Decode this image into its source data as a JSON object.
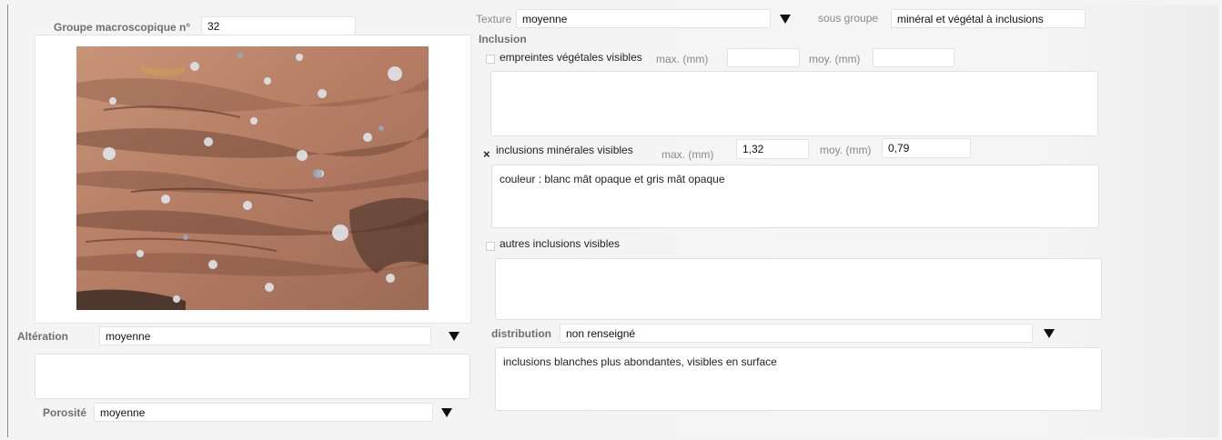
{
  "left": {
    "group_label": "Groupe macroscopique n°",
    "group_value": "32",
    "photo_alt": "Photo de l'échantillon",
    "alteration_label": "Altération",
    "alteration_value": "moyenne",
    "alteration_notes": "",
    "porosity_label": "Porosité",
    "porosity_value": "moyenne"
  },
  "texture": {
    "label": "Texture",
    "value": "moyenne",
    "subgroup_label": "sous groupe",
    "subgroup_value": "minéral et végétal à inclusions"
  },
  "inclusion": {
    "heading": "Inclusion",
    "vegetal": {
      "checked": false,
      "label": "empreintes végétales visibles",
      "max_label": "max. (mm)",
      "max_value": "",
      "moy_label": "moy. (mm)",
      "moy_value": "",
      "notes": ""
    },
    "mineral": {
      "checked": true,
      "check_glyph": "×",
      "label": "inclusions minérales visibles",
      "max_label": "max. (mm)",
      "max_value": "1,32",
      "moy_label": "moy. (mm)",
      "moy_value": "0,79",
      "notes": "couleur : blanc mât opaque et gris mât opaque"
    },
    "other": {
      "checked": false,
      "label": "autres inclusions visibles",
      "notes": ""
    },
    "distribution_label": "distribution",
    "distribution_value": "non renseigné",
    "distribution_notes": "inclusions blanches plus abondantes, visibles en surface"
  },
  "icons": {
    "dropdown": "chevron-down-icon",
    "checked": "x-mark-icon"
  },
  "colors": {
    "label_gray": "#6f6f6f",
    "field_bg": "#ffffff",
    "page_bg": "#f4f4f4",
    "stone": "#b7826a"
  }
}
